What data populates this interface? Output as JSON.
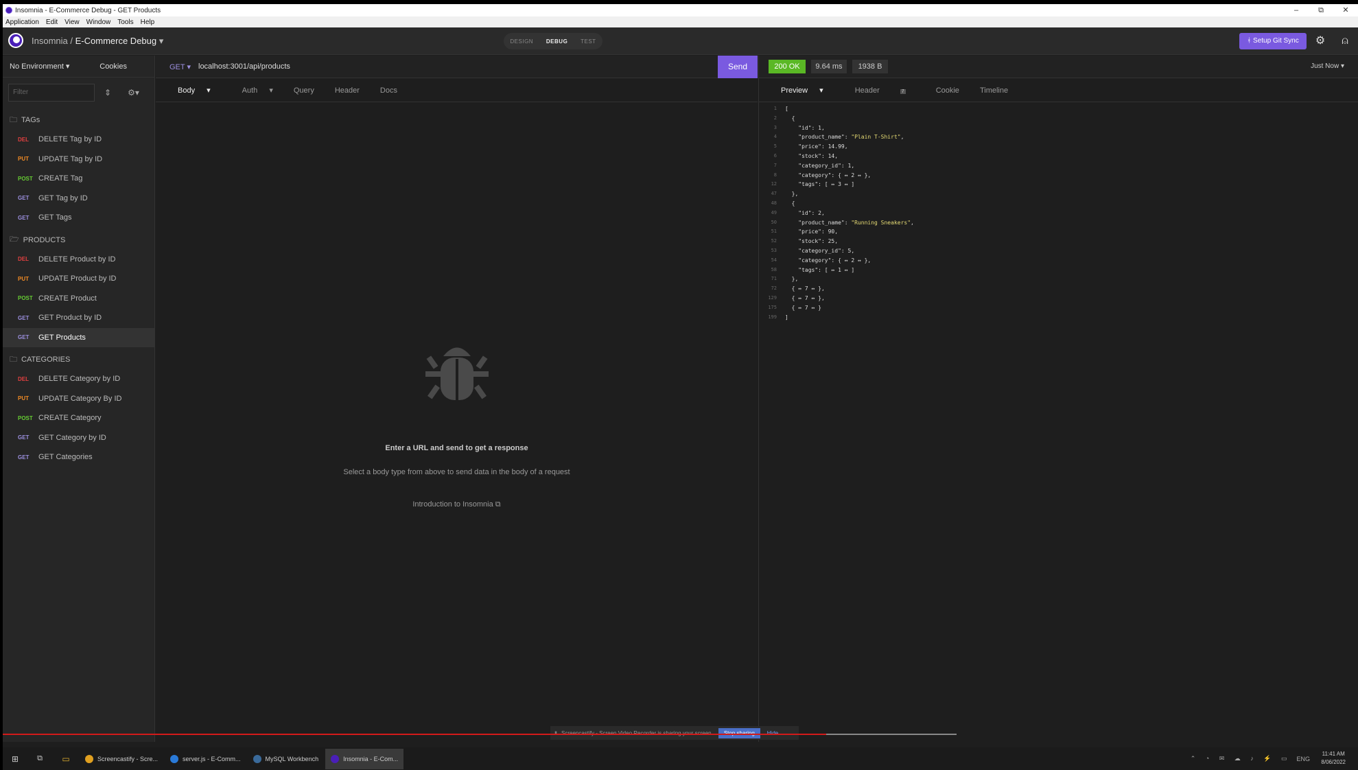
{
  "window": {
    "title": "Insomnia - E-Commerce Debug - GET Products",
    "min": "–",
    "restore": "⧉",
    "close": "✕"
  },
  "menu": [
    "Application",
    "Edit",
    "View",
    "Window",
    "Tools",
    "Help"
  ],
  "header": {
    "app": "Insomnia",
    "separator": "/",
    "workspace": "E-Commerce Debug",
    "modes": [
      "DESIGN",
      "DEBUG",
      "TEST"
    ],
    "active_mode": "DEBUG",
    "sync_label": "Setup Git Sync"
  },
  "sidebar": {
    "environment": "No Environment",
    "cookies": "Cookies",
    "filter_placeholder": "Filter",
    "folders": [
      {
        "name": "TAGs",
        "requests": [
          {
            "method": "DEL",
            "label": "DELETE Tag by ID"
          },
          {
            "method": "PUT",
            "label": "UPDATE Tag by ID"
          },
          {
            "method": "POST",
            "label": "CREATE Tag"
          },
          {
            "method": "GET",
            "label": "GET Tag by ID"
          },
          {
            "method": "GET",
            "label": "GET Tags"
          }
        ]
      },
      {
        "name": "PRODUCTS",
        "requests": [
          {
            "method": "DEL",
            "label": "DELETE Product by ID"
          },
          {
            "method": "PUT",
            "label": "UPDATE Product by ID"
          },
          {
            "method": "POST",
            "label": "CREATE Product"
          },
          {
            "method": "GET",
            "label": "GET Product by ID"
          },
          {
            "method": "GET",
            "label": "GET Products"
          }
        ]
      },
      {
        "name": "CATEGORIES",
        "requests": [
          {
            "method": "DEL",
            "label": "DELETE Category by ID"
          },
          {
            "method": "PUT",
            "label": "UPDATE Category By ID"
          },
          {
            "method": "POST",
            "label": "CREATE Category"
          },
          {
            "method": "GET",
            "label": "GET Category by ID"
          },
          {
            "method": "GET",
            "label": "GET Categories"
          }
        ]
      }
    ],
    "active_request": "GET Products"
  },
  "request": {
    "method": "GET",
    "url": "localhost:3001/api/products",
    "send": "Send",
    "tabs": [
      "Body",
      "Auth",
      "Query",
      "Header",
      "Docs"
    ],
    "empty_title": "Enter a URL and send to get a response",
    "empty_hint": "Select a body type from above to send data in the body of a request",
    "intro_link": "Introduction to Insomnia"
  },
  "response": {
    "status": "200 OK",
    "time": "9.64 ms",
    "size": "1938 B",
    "when": "Just Now",
    "tabs": [
      "Preview",
      "Header",
      "Cookie",
      "Timeline"
    ],
    "header_count": "7",
    "lines": [
      {
        "n": "1",
        "t": "["
      },
      {
        "n": "2",
        "t": "  {"
      },
      {
        "n": "3",
        "t": "    \"id\": 1,"
      },
      {
        "n": "4",
        "t": "    \"product_name\": \"Plain T-Shirt\","
      },
      {
        "n": "5",
        "t": "    \"price\": 14.99,"
      },
      {
        "n": "6",
        "t": "    \"stock\": 14,"
      },
      {
        "n": "7",
        "t": "    \"category_id\": 1,"
      },
      {
        "n": "8",
        "t": "    \"category\": { ↔ 2 ↔ },"
      },
      {
        "n": "12",
        "t": "    \"tags\": [ ↔ 3 ↔ ]"
      },
      {
        "n": "47",
        "t": "  },"
      },
      {
        "n": "48",
        "t": "  {"
      },
      {
        "n": "49",
        "t": "    \"id\": 2,"
      },
      {
        "n": "50",
        "t": "    \"product_name\": \"Running Sneakers\","
      },
      {
        "n": "51",
        "t": "    \"price\": 90,"
      },
      {
        "n": "52",
        "t": "    \"stock\": 25,"
      },
      {
        "n": "53",
        "t": "    \"category_id\": 5,"
      },
      {
        "n": "54",
        "t": "    \"category\": { ↔ 2 ↔ },"
      },
      {
        "n": "58",
        "t": "    \"tags\": [ ↔ 1 ↔ ]"
      },
      {
        "n": "71",
        "t": "  },"
      },
      {
        "n": "72",
        "t": "  { ↔ 7 ↔ },"
      },
      {
        "n": "129",
        "t": "  { ↔ 7 ↔ },"
      },
      {
        "n": "175",
        "t": "  { ↔ 7 ↔ }"
      },
      {
        "n": "199",
        "t": "]"
      }
    ]
  },
  "share_banner": {
    "text": "Screencastify - Screen Video Recorder is sharing your screen.",
    "stop": "Stop sharing",
    "hide": "Hide"
  },
  "taskbar": {
    "apps": [
      {
        "label": "Screencastify - Scre...",
        "color": "#e0a020"
      },
      {
        "label": "server.js - E-Comm...",
        "color": "#2a7ad8"
      },
      {
        "label": "MySQL Workbench",
        "color": "#3a6a9a"
      },
      {
        "label": "Insomnia - E-Com...",
        "color": "#4a1fb8"
      }
    ],
    "lang": "ENG",
    "time": "11:41 AM",
    "date": "8/06/2022"
  },
  "colors": {
    "accent": "#7a5ae0",
    "ok": "#5ab825",
    "del": "#e04040",
    "put": "#f08a24",
    "post": "#66cc33",
    "get": "#9c8fdf"
  }
}
